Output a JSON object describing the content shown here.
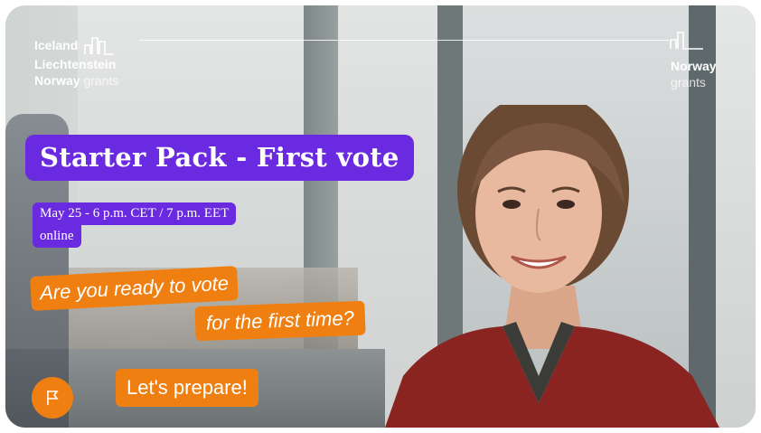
{
  "logos": {
    "left": {
      "line1": "Iceland",
      "line2": "Liechtenstein",
      "line3_bold": "Norway",
      "line3_light": "grants"
    },
    "right": {
      "line1": "Norway",
      "line2": "grants"
    }
  },
  "event": {
    "title": "Starter Pack - First vote",
    "date_time": "May 25  -  6 p.m. CET / 7 p.m. EET",
    "location": "online"
  },
  "prompts": {
    "question_line1": "Are you ready to vote",
    "question_line2": "for the first time?",
    "cta_label": "Let's prepare!"
  },
  "icons": {
    "flag": "flag-icon",
    "logo_mark": "building-logo-icon"
  },
  "colors": {
    "purple": "#6a2be0",
    "orange": "#f07f11"
  }
}
